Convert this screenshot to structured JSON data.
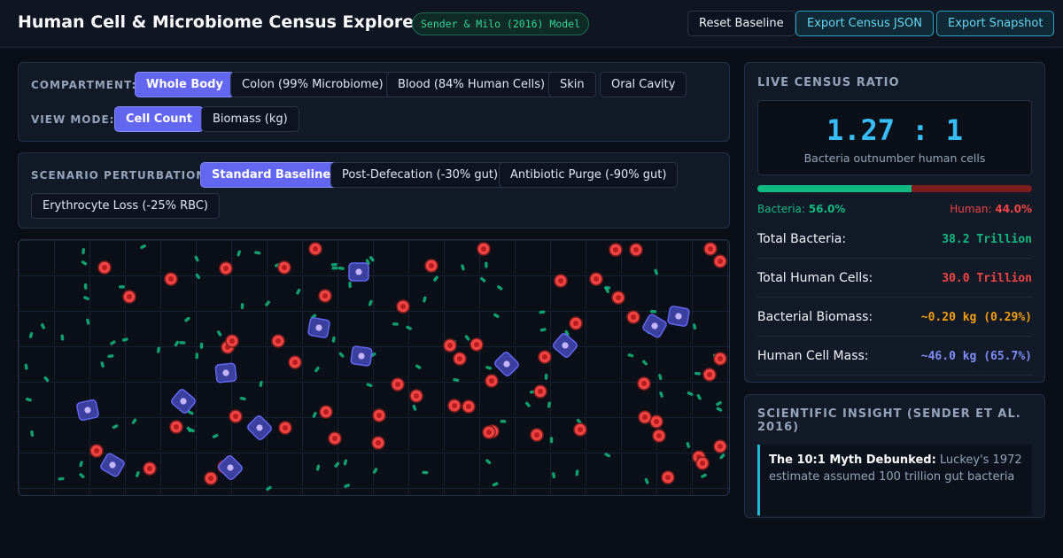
{
  "header": {
    "title": "Human Cell & Microbiome Census Explorer",
    "badge": "Sender & Milo (2016) Model",
    "reset_label": "Reset Baseline",
    "export_json_label": "Export Census JSON",
    "export_snapshot_label": "Export Snapshot"
  },
  "controls": {
    "compartment_label": "COMPARTMENT:",
    "compartments": [
      "Whole Body",
      "Colon (99% Microbiome)",
      "Blood (84% Human Cells)",
      "Skin",
      "Oral Cavity"
    ],
    "compartment_selected": "Whole Body",
    "view_mode_label": "VIEW MODE:",
    "view_modes": [
      "Cell Count",
      "Biomass (kg)"
    ],
    "view_mode_selected": "Cell Count",
    "scenario_label": "SCENARIO PERTURBATION:",
    "scenarios": [
      "Standard Baseline",
      "Post-Defecation (-30% gut)",
      "Antibiotic Purge (-90% gut)",
      "Erythrocyte Loss (-25% RBC)"
    ],
    "scenario_selected": "Standard Baseline"
  },
  "ratio_panel": {
    "heading": "LIVE CENSUS RATIO",
    "ratio": "1.27 : 1",
    "ratio_caption": "Bacteria outnumber human cells",
    "bacteria_fraction": 0.56,
    "bacteria_label": "Bacteria:",
    "bacteria_pct": "56.0%",
    "human_label": "Human:",
    "human_pct": "44.0%",
    "stats": [
      {
        "label": "Total Bacteria:",
        "value": "38.2 Trillion",
        "color": "#10b981"
      },
      {
        "label": "Total Human Cells:",
        "value": "30.0 Trillion",
        "color": "#ef4444"
      },
      {
        "label": "Bacterial Biomass:",
        "value": "~0.20 kg (0.29%)",
        "color": "#f59e0b"
      },
      {
        "label": "Human Cell Mass:",
        "value": "~46.0 kg (65.7%)",
        "color": "#818cf8"
      }
    ]
  },
  "insight_panel": {
    "heading": "SCIENTIFIC INSIGHT (SENDER ET AL. 2016)",
    "lead": "The 10:1 Myth Debunked:",
    "body": "Luckey's 1972 estimate assumed 100 trillion gut bacteria"
  },
  "colors": {
    "bacteria": "#10b981",
    "red_blood_cell": "#ef4444",
    "human_cell": "#6366f1",
    "accent": "#38bdf8"
  }
}
